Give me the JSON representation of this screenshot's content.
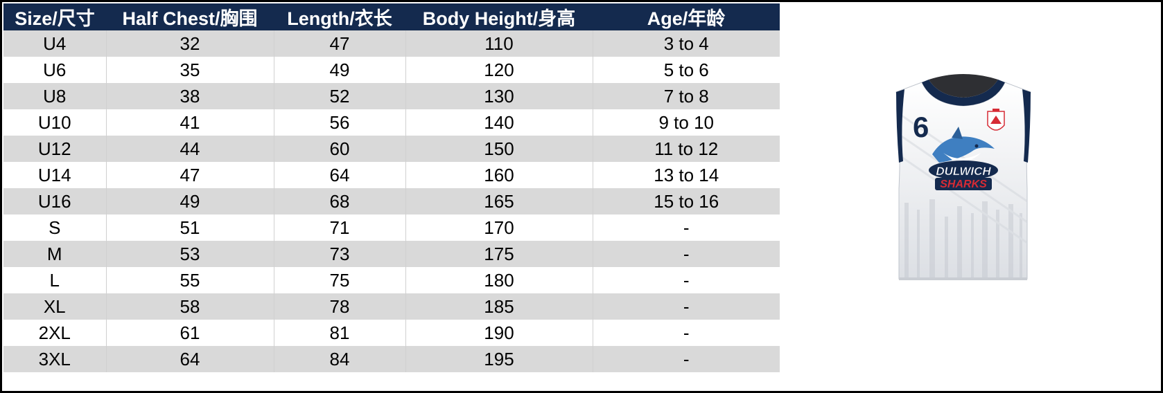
{
  "headers": [
    "Size/尺寸",
    "Half Chest/胸围",
    "Length/衣长",
    "Body Height/身高",
    "Age/年龄"
  ],
  "rows": [
    [
      "U4",
      "32",
      "47",
      "110",
      "3 to 4"
    ],
    [
      "U6",
      "35",
      "49",
      "120",
      "5 to 6"
    ],
    [
      "U8",
      "38",
      "52",
      "130",
      "7 to 8"
    ],
    [
      "U10",
      "41",
      "56",
      "140",
      "9 to 10"
    ],
    [
      "U12",
      "44",
      "60",
      "150",
      "11 to 12"
    ],
    [
      "U14",
      "47",
      "64",
      "160",
      "13 to 14"
    ],
    [
      "U16",
      "49",
      "68",
      "165",
      "15 to 16"
    ],
    [
      "S",
      "51",
      "71",
      "170",
      "-"
    ],
    [
      "M",
      "53",
      "73",
      "175",
      "-"
    ],
    [
      "L",
      "55",
      "75",
      "180",
      "-"
    ],
    [
      "XL",
      "58",
      "78",
      "185",
      "-"
    ],
    [
      "2XL",
      "61",
      "81",
      "190",
      "-"
    ],
    [
      "3XL",
      "64",
      "84",
      "195",
      "-"
    ]
  ],
  "jersey": {
    "number": "6",
    "team_line1": "DULWICH",
    "team_line2": "SHARKS",
    "colors": {
      "trim": "#142a4e",
      "accent": "#d62b35",
      "body": "#ffffff"
    }
  }
}
